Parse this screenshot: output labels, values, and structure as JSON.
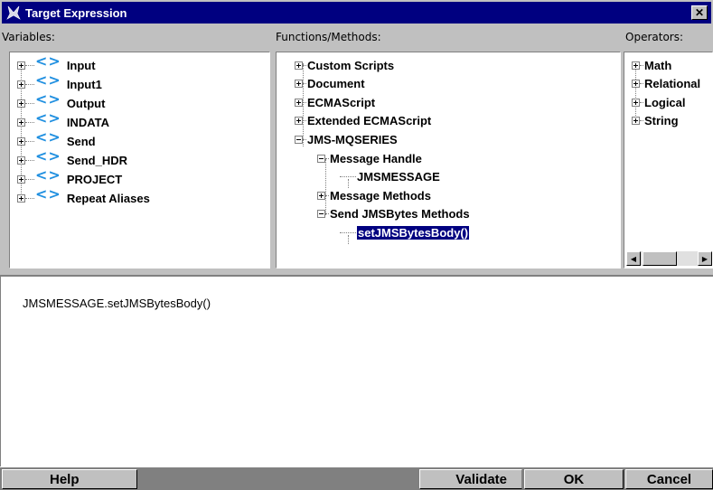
{
  "window": {
    "title": "Target Expression",
    "close_label": "✕"
  },
  "variables": {
    "label": "Variables:",
    "items": [
      {
        "label": "Input"
      },
      {
        "label": "Input1"
      },
      {
        "label": "Output"
      },
      {
        "label": "INDATA"
      },
      {
        "label": "Send"
      },
      {
        "label": "Send_HDR"
      },
      {
        "label": "PROJECT"
      },
      {
        "label": "Repeat Aliases"
      }
    ],
    "chevron": "<>"
  },
  "functions": {
    "label": "Functions/Methods:",
    "items": [
      {
        "label": "Custom Scripts",
        "level": 0,
        "toggle": "plus"
      },
      {
        "label": "Document",
        "level": 0,
        "toggle": "plus"
      },
      {
        "label": "ECMAScript",
        "level": 0,
        "toggle": "plus"
      },
      {
        "label": "Extended ECMAScript",
        "level": 0,
        "toggle": "plus"
      },
      {
        "label": "JMS-MQSERIES",
        "level": 0,
        "toggle": "minus"
      },
      {
        "label": "Message Handle",
        "level": 1,
        "toggle": "minus"
      },
      {
        "label": "JMSMESSAGE",
        "level": 2,
        "toggle": "none"
      },
      {
        "label": "Message Methods",
        "level": 1,
        "toggle": "plus"
      },
      {
        "label": "Send JMSBytes Methods",
        "level": 1,
        "toggle": "minus"
      },
      {
        "label": "setJMSBytesBody()",
        "level": 2,
        "toggle": "none",
        "selected": true
      }
    ]
  },
  "operators": {
    "label": "Operators:",
    "items": [
      {
        "label": "Math"
      },
      {
        "label": "Relational"
      },
      {
        "label": "Logical"
      },
      {
        "label": "String"
      }
    ]
  },
  "expression": {
    "text": "JMSMESSAGE.setJMSBytesBody()"
  },
  "buttons": {
    "help": "Help",
    "validate": "Validate",
    "ok": "OK",
    "cancel": "Cancel"
  },
  "colors": {
    "title_bar": "#000080",
    "selection": "#000080",
    "chevron": "#1f8fe0"
  }
}
